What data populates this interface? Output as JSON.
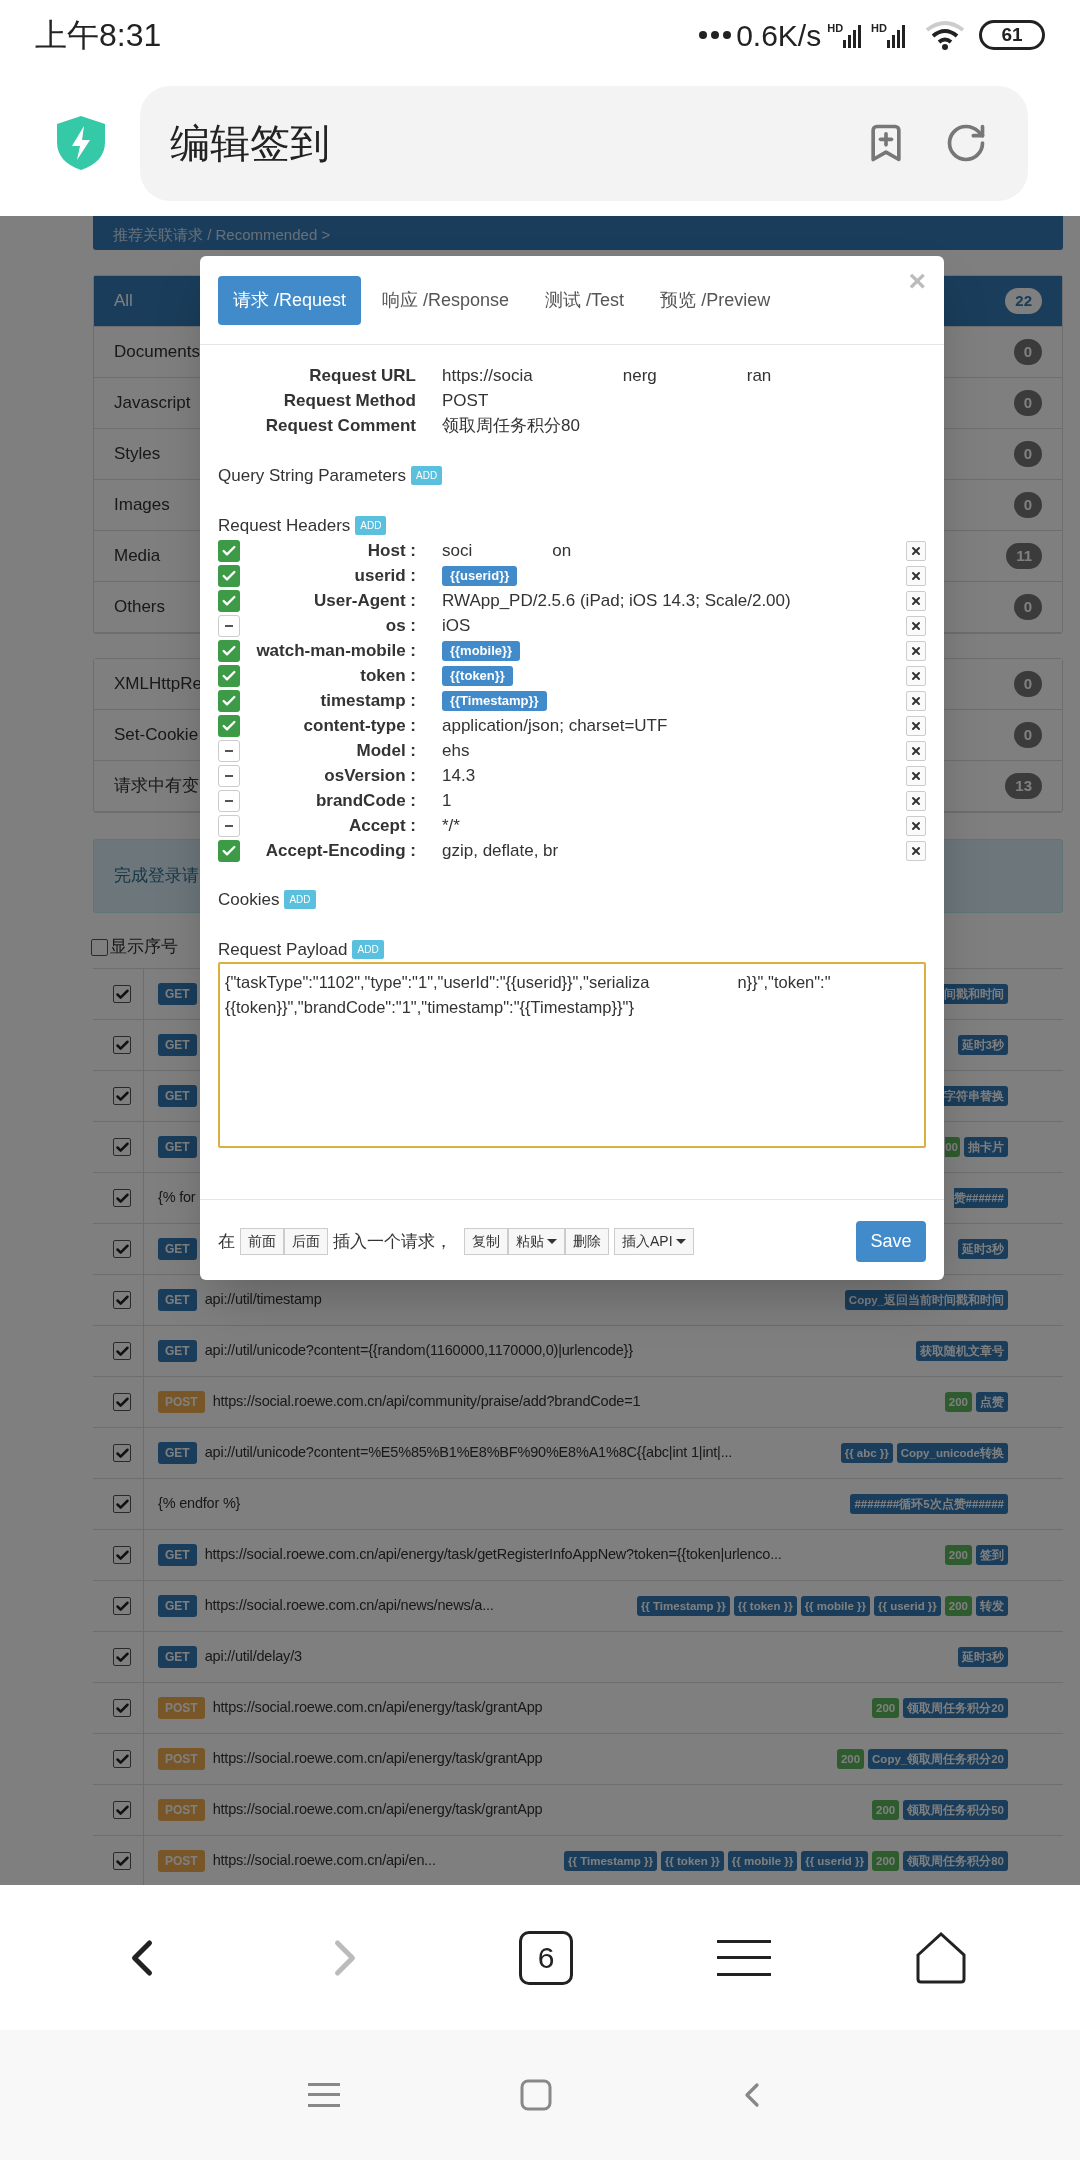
{
  "status_bar": {
    "time": "上午8:31",
    "speed": "0.6K/s",
    "signals": [
      {
        "label": "HD"
      },
      {
        "label": "HD"
      }
    ],
    "battery": "61"
  },
  "address_bar": {
    "title": "编辑签到"
  },
  "recommended": "推荐关联请求 / Recommended >",
  "filters": [
    {
      "label": "All",
      "count": "22",
      "selected": true
    },
    {
      "label": "Documents",
      "count": "0",
      "selected": false
    },
    {
      "label": "Javascript",
      "count": "0",
      "selected": false
    },
    {
      "label": "Styles",
      "count": "0",
      "selected": false
    },
    {
      "label": "Images",
      "count": "0",
      "selected": false
    },
    {
      "label": "Media",
      "count": "11",
      "selected": false
    },
    {
      "label": "Others",
      "count": "0",
      "selected": false
    }
  ],
  "filters_2": [
    {
      "label": "XMLHttpRe",
      "count": "0"
    },
    {
      "label": "Set-Cookie",
      "count": "0"
    },
    {
      "label": "请求中有变",
      "count": "13"
    }
  ],
  "login_panel": "完成登录请",
  "show_index": {
    "label": "显示序号",
    "checked": false
  },
  "rows": [
    {
      "checked": true,
      "method": "GET",
      "text": "",
      "tags": [
        {
          "kind": "label_cut",
          "text": "间戳和时间"
        }
      ]
    },
    {
      "checked": true,
      "method": "GET",
      "text": "",
      "tags": [
        {
          "kind": "label",
          "text": "延时3秒"
        }
      ]
    },
    {
      "checked": true,
      "method": "GET",
      "text": "",
      "tags": [
        {
          "kind": "label_cut",
          "text": "字符串替换"
        }
      ]
    },
    {
      "checked": true,
      "method": "GET",
      "text": "",
      "tags": [
        {
          "kind": "status_cut",
          "text": "00"
        },
        {
          "kind": "label",
          "text": "抽卡片"
        }
      ]
    },
    {
      "checked": true,
      "method": "",
      "text": "{% for",
      "tags": [
        {
          "kind": "label_cut",
          "text": "赞######"
        }
      ]
    },
    {
      "checked": true,
      "method": "GET",
      "text": "",
      "tags": [
        {
          "kind": "label",
          "text": "延时3秒"
        }
      ]
    },
    {
      "checked": true,
      "method": "GET",
      "text": "api://util/timestamp",
      "tags": [
        {
          "kind": "label",
          "text": "Copy_返回当前时间戳和时间"
        }
      ]
    },
    {
      "checked": true,
      "method": "GET",
      "text": "api://util/unicode?content={{random(1160000,1170000,0)|urlencode}}",
      "tags": [
        {
          "kind": "label",
          "text": "获取随机文章号"
        }
      ]
    },
    {
      "checked": true,
      "method": "POST",
      "text": "https://social.roewe.com.cn/api/community/praise/add?brandCode=1",
      "tags": [
        {
          "kind": "status",
          "text": "200"
        },
        {
          "kind": "label",
          "text": "点赞"
        }
      ]
    },
    {
      "checked": true,
      "method": "GET",
      "text": "api://util/unicode?content=%E5%85%B1%E8%BF%90%E8%A1%8C{{abc|int 1|int|...",
      "tags": [
        {
          "kind": "label",
          "text": "{{ abc }}"
        },
        {
          "kind": "label",
          "text": "Copy_unicode转换"
        }
      ]
    },
    {
      "checked": true,
      "method": "",
      "text": "{% endfor %}",
      "tags": [
        {
          "kind": "label",
          "text": "#######循环5次点赞######"
        }
      ]
    },
    {
      "checked": true,
      "method": "GET",
      "text": "https://social.roewe.com.cn/api/energy/task/getRegisterInfoAppNew?token={{token|urlenco...",
      "tags": [
        {
          "kind": "status",
          "text": "200"
        },
        {
          "kind": "label",
          "text": "签到"
        }
      ]
    },
    {
      "checked": true,
      "method": "GET",
      "text": "https://social.roewe.com.cn/api/news/news/a...",
      "tags": [
        {
          "kind": "label",
          "text": "{{ Timestamp }}"
        },
        {
          "kind": "label",
          "text": "{{ token }}"
        },
        {
          "kind": "label",
          "text": "{{ mobile }}"
        },
        {
          "kind": "label",
          "text": "{{ userid }}"
        },
        {
          "kind": "status",
          "text": "200"
        },
        {
          "kind": "label",
          "text": "转发"
        }
      ]
    },
    {
      "checked": true,
      "method": "GET",
      "text": "api://util/delay/3",
      "tags": [
        {
          "kind": "label",
          "text": "延时3秒"
        }
      ]
    },
    {
      "checked": true,
      "method": "POST",
      "text": "https://social.roewe.com.cn/api/energy/task/grantApp",
      "tags": [
        {
          "kind": "status",
          "text": "200"
        },
        {
          "kind": "label",
          "text": "领取周任务积分20"
        }
      ]
    },
    {
      "checked": true,
      "method": "POST",
      "text": "https://social.roewe.com.cn/api/energy/task/grantApp",
      "tags": [
        {
          "kind": "status",
          "text": "200"
        },
        {
          "kind": "label",
          "text": "Copy_领取周任务积分20"
        }
      ]
    },
    {
      "checked": true,
      "method": "POST",
      "text": "https://social.roewe.com.cn/api/energy/task/grantApp",
      "tags": [
        {
          "kind": "status",
          "text": "200"
        },
        {
          "kind": "label",
          "text": "领取周任务积分50"
        }
      ]
    },
    {
      "checked": true,
      "method": "POST",
      "text": "https://social.roewe.com.cn/api/en...",
      "tags": [
        {
          "kind": "label",
          "text": "{{ Timestamp }}"
        },
        {
          "kind": "label",
          "text": "{{ token }}"
        },
        {
          "kind": "label",
          "text": "{{ mobile }}"
        },
        {
          "kind": "label",
          "text": "{{ userid }}"
        },
        {
          "kind": "status",
          "text": "200"
        },
        {
          "kind": "label",
          "text": "领取周任务积分80"
        }
      ]
    }
  ],
  "modal": {
    "tabs": [
      {
        "label": "请求 /Request",
        "selected": true
      },
      {
        "label": "响应 /Response",
        "selected": false
      },
      {
        "label": "测试 /Test",
        "selected": false
      },
      {
        "label": "预览 /Preview",
        "selected": false
      }
    ],
    "close": "×",
    "info": [
      {
        "label": "Request URL",
        "fragments": [
          "https://socia",
          "nerg",
          "ran"
        ]
      },
      {
        "label": "Request Method",
        "fragments": [
          "POST"
        ]
      },
      {
        "label": "Request Comment",
        "fragments": [
          "领取周任务积分80"
        ]
      }
    ],
    "query": {
      "title": "Query String Parameters",
      "add": "ADD"
    },
    "headers_section": {
      "title": "Request Headers",
      "add": "ADD"
    },
    "cookies": {
      "title": "Cookies",
      "add": "ADD"
    },
    "payload": {
      "title": "Request Payload",
      "add": "ADD"
    },
    "headers": [
      {
        "name": "Host :",
        "enabled": true,
        "kind": "fragments",
        "fragments": [
          "soci",
          "on"
        ]
      },
      {
        "name": "userid :",
        "enabled": true,
        "kind": "var",
        "value": "{{userid}}"
      },
      {
        "name": "User-Agent :",
        "enabled": true,
        "kind": "text",
        "value": "RWApp_PD/2.5.6 (iPad; iOS 14.3; Scale/2.00)"
      },
      {
        "name": "os :",
        "enabled": false,
        "kind": "text",
        "value": "iOS"
      },
      {
        "name": "watch-man-mobile :",
        "enabled": true,
        "kind": "var",
        "value": "{{mobile}}"
      },
      {
        "name": "token :",
        "enabled": true,
        "kind": "var",
        "value": "{{token}}"
      },
      {
        "name": "timestamp :",
        "enabled": true,
        "kind": "var",
        "value": "{{Timestamp}}"
      },
      {
        "name": "content-type :",
        "enabled": true,
        "kind": "text",
        "value": "application/json; charset=UTF"
      },
      {
        "name": "Model :",
        "enabled": false,
        "kind": "text",
        "value": "ehs"
      },
      {
        "name": "osVersion :",
        "enabled": false,
        "kind": "text",
        "value": "14.3"
      },
      {
        "name": "brandCode :",
        "enabled": false,
        "kind": "text",
        "value": "1"
      },
      {
        "name": "Accept :",
        "enabled": false,
        "kind": "text",
        "value": "*/*"
      },
      {
        "name": "Accept-Encoding :",
        "enabled": true,
        "kind": "text",
        "value": "gzip, deflate, br"
      }
    ],
    "payload_lines": [
      [
        "{\"taskType\":\"1102\",\"type\":\"1\",\"userId\":\"{{userid}}\",\"serializa",
        "n}}\",\"token\":\""
      ],
      [
        "{{token}}\",\"brandCode\":\"1\",\"timestamp\":\"{{Timestamp}}\"}"
      ]
    ],
    "footer": {
      "prefix": "在",
      "group1": [
        "前面",
        "后面"
      ],
      "middle": "插入一个请求，",
      "group2": [
        {
          "label": "复制",
          "dropdown": false
        },
        {
          "label": "粘贴",
          "dropdown": true
        },
        {
          "label": "删除",
          "dropdown": false
        }
      ],
      "insert_api": "插入API",
      "save": "Save"
    }
  },
  "bottom_nav": {
    "tab_count": "6"
  }
}
